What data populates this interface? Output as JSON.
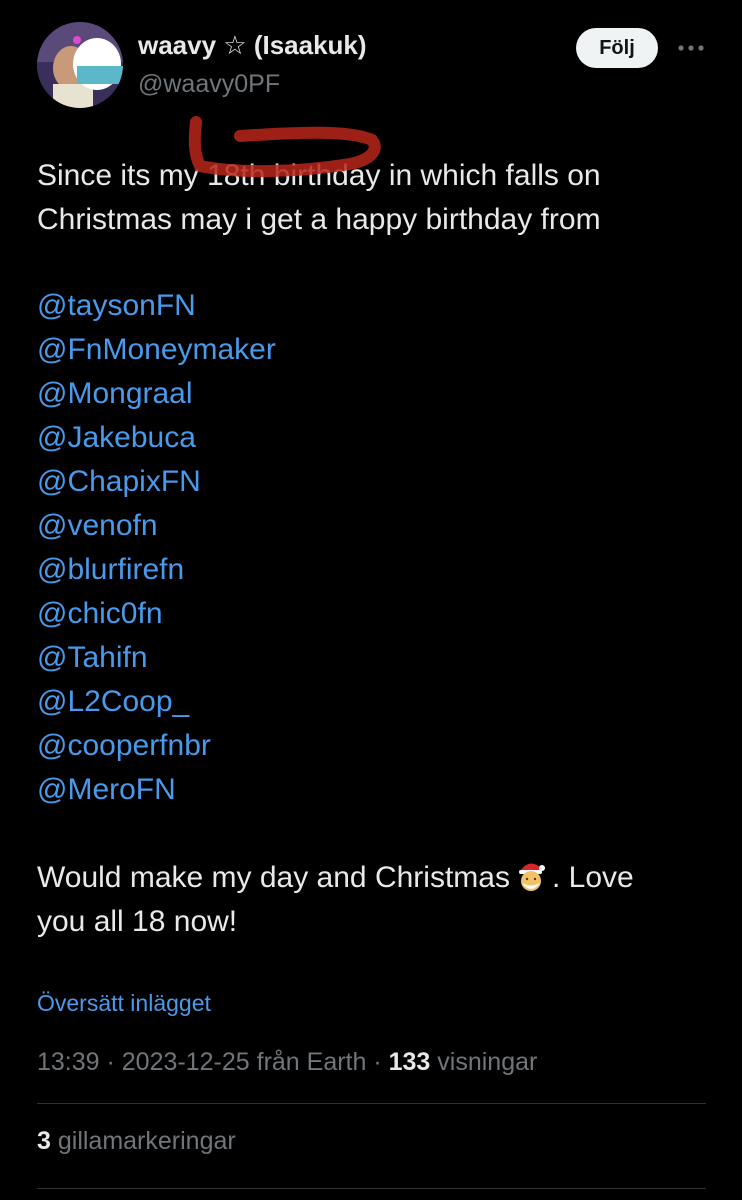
{
  "author": {
    "display_name": "waavy ☆ (Isaakuk)",
    "handle": "@waavy0PF",
    "follow_label": "Följ"
  },
  "tweet": {
    "text_line1": "Since its my 18th birthday in which falls on",
    "text_line2": "Christmas may i get a happy birthday from",
    "mentions": [
      "@taysonFN",
      "@FnMoneymaker",
      "@Mongraal",
      "@Jakebuca",
      "@ChapixFN",
      "@venofn",
      "@blurfirefn",
      "@chic0fn",
      "@Tahifn",
      "@L2Coop_",
      "@cooperfnbr",
      "@MeroFN"
    ],
    "closing_line1_a": "Would make my day and Christmas",
    "closing_line1_b": ". Love",
    "closing_line2": "you all 18 now!",
    "translate_label": "Översätt inlägget"
  },
  "meta": {
    "time": "13:39",
    "date": "2023-12-25",
    "source": "från Earth",
    "views_count": "133",
    "views_label": "visningar",
    "separator": " · "
  },
  "likes": {
    "count": "3",
    "label": "gillamarkeringar"
  },
  "icons": {
    "more": "more-horizontal-icon",
    "emoji": "santa-emoji-icon"
  },
  "colors": {
    "background": "#000000",
    "text": "#e7e9ea",
    "secondary": "#71767b",
    "link": "#4a9aeb",
    "annotation": "#b8261a"
  }
}
